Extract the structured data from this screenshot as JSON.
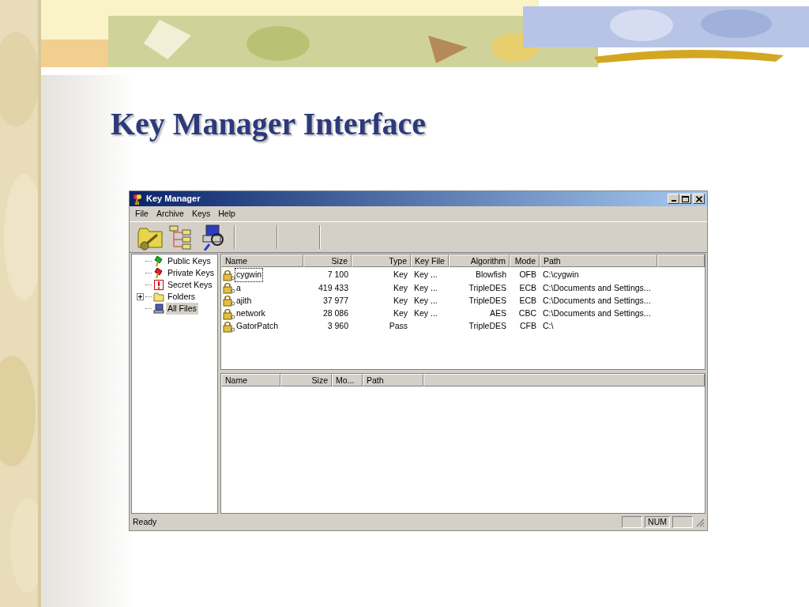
{
  "slide": {
    "title": "Key Manager Interface"
  },
  "window": {
    "title": "Key Manager"
  },
  "menu": [
    "File",
    "Archive",
    "Keys",
    "Help"
  ],
  "tree": [
    {
      "label": "Public Keys",
      "kind": "public",
      "collapsed": false,
      "selected": false
    },
    {
      "label": "Private Keys",
      "kind": "private",
      "collapsed": false,
      "selected": false
    },
    {
      "label": "Secret Keys",
      "kind": "secret",
      "collapsed": false,
      "selected": false
    },
    {
      "label": "Folders",
      "kind": "folder",
      "collapsed": true,
      "selected": false
    },
    {
      "label": "All Files",
      "kind": "files",
      "collapsed": false,
      "selected": true
    }
  ],
  "key_table": {
    "columns": [
      "Name",
      "Size",
      "Type",
      "Key File",
      "Algorithm",
      "Mode",
      "Path"
    ],
    "rows": [
      {
        "cells": [
          "cygwin",
          "7 100",
          "Key",
          "Key ...",
          "Blowfish",
          "OFB",
          "C:\\cygwin"
        ],
        "focused": true
      },
      {
        "cells": [
          "a",
          "419 433",
          "Key",
          "Key ...",
          "TripleDES",
          "ECB",
          "C:\\Documents and Settings..."
        ],
        "focused": false
      },
      {
        "cells": [
          "ajith",
          "37 977",
          "Key",
          "Key ...",
          "TripleDES",
          "ECB",
          "C:\\Documents and Settings..."
        ],
        "focused": false
      },
      {
        "cells": [
          "network",
          "28 086",
          "Key",
          "Key ...",
          "AES",
          "CBC",
          "C:\\Documents and Settings..."
        ],
        "focused": false
      },
      {
        "cells": [
          "GatorPatch",
          "3 960",
          "Pass",
          null,
          "TripleDES",
          "CFB",
          "C:\\"
        ],
        "focused": false
      }
    ]
  },
  "file_table": {
    "columns": [
      "Name",
      "Size",
      "Mo...",
      "Path"
    ]
  },
  "status_bar": {
    "text": "Ready",
    "indicators": [
      "NUM"
    ]
  }
}
